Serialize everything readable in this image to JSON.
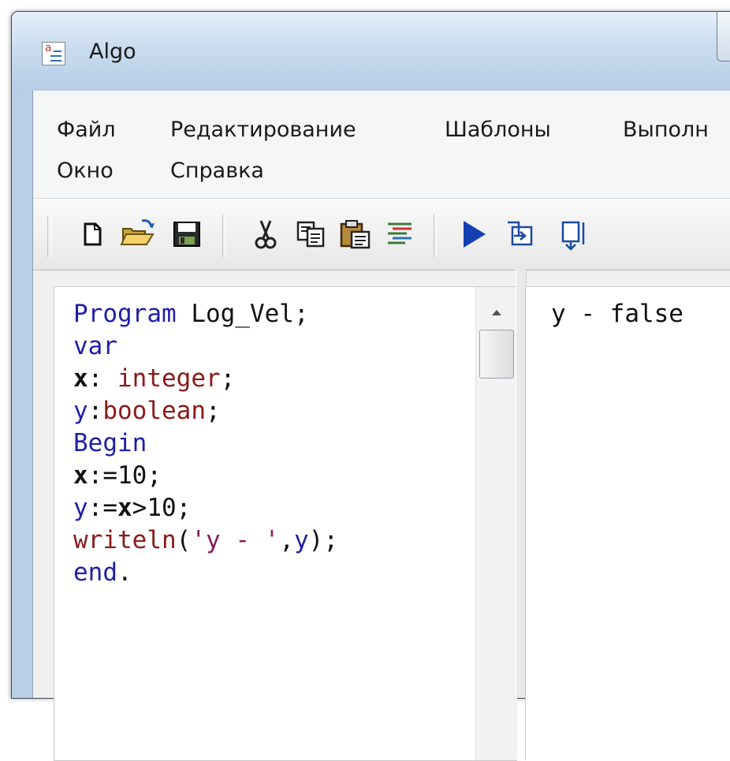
{
  "window": {
    "title": "Algo"
  },
  "menu": {
    "items": [
      "Файл",
      "Редактирование",
      "Шаблоны",
      "Выполн",
      "Окно",
      "Справка"
    ]
  },
  "toolbar": {
    "buttons": [
      "new-file-icon",
      "open-folder-icon",
      "save-icon",
      "cut-icon",
      "copy-icon",
      "paste-icon",
      "format-code-icon",
      "run-icon",
      "step-into-icon",
      "step-over-icon"
    ]
  },
  "editor": {
    "lines": [
      [
        {
          "t": "Program",
          "c": "kw"
        },
        {
          "t": " Log_Vel;",
          "c": "pl"
        }
      ],
      [
        {
          "t": "var",
          "c": "kw"
        }
      ],
      [
        {
          "t": "x",
          "c": "bd"
        },
        {
          "t": ":",
          "c": "pu"
        },
        {
          "t": " integer",
          "c": "tp"
        },
        {
          "t": ";",
          "c": "pu"
        }
      ],
      [
        {
          "t": "y",
          "c": "kw"
        },
        {
          "t": ":",
          "c": "pu"
        },
        {
          "t": "boolean",
          "c": "tp"
        },
        {
          "t": ";",
          "c": "pu"
        }
      ],
      [
        {
          "t": "Begin",
          "c": "kw"
        }
      ],
      [
        {
          "t": "x",
          "c": "bd"
        },
        {
          "t": ":=",
          "c": "pu"
        },
        {
          "t": "10",
          "c": "pl"
        },
        {
          "t": ";",
          "c": "pu"
        }
      ],
      [
        {
          "t": "y",
          "c": "kw"
        },
        {
          "t": ":=",
          "c": "pu"
        },
        {
          "t": "x",
          "c": "bd"
        },
        {
          "t": ">",
          "c": "pu"
        },
        {
          "t": "10",
          "c": "pl"
        },
        {
          "t": ";",
          "c": "pu"
        }
      ],
      [
        {
          "t": "writeln",
          "c": "tp"
        },
        {
          "t": "(",
          "c": "pu"
        },
        {
          "t": "'y - '",
          "c": "st"
        },
        {
          "t": ",",
          "c": "pu"
        },
        {
          "t": "y",
          "c": "kw"
        },
        {
          "t": ");",
          "c": "pu"
        }
      ],
      [
        {
          "t": "end",
          "c": "kw"
        },
        {
          "t": ".",
          "c": "pu"
        }
      ]
    ]
  },
  "output": {
    "text": "y - false"
  },
  "colors": {
    "keyword": "#1f1fa8",
    "type": "#8b1a1a",
    "string": "#8a1a5a",
    "titlebar": "#cadcef"
  }
}
